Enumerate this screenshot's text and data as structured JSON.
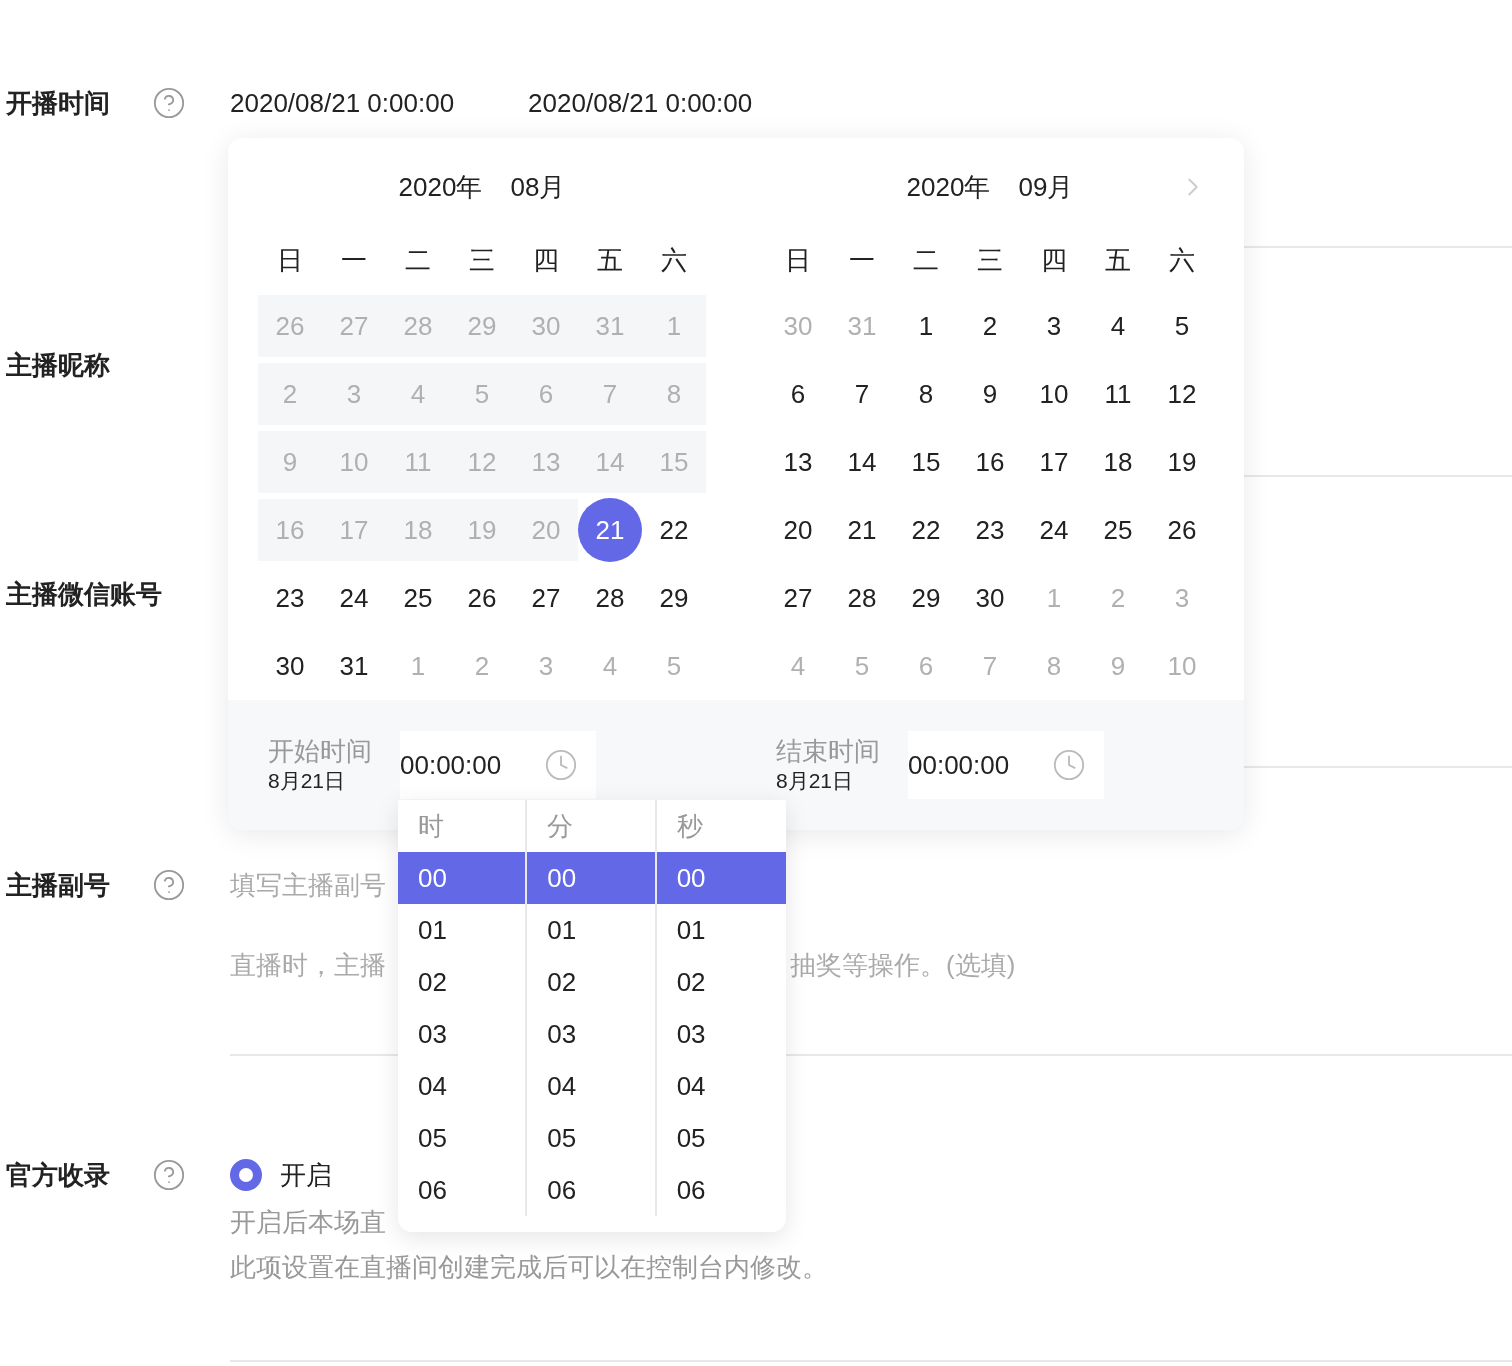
{
  "form": {
    "rows": [
      {
        "label": "开播时间",
        "help": true,
        "kind": "time_range",
        "start": "2020/08/21 0:00:00",
        "end": "2020/08/21 0:00:00"
      },
      {
        "label": "主播昵称",
        "help": false,
        "kind": "empty"
      },
      {
        "label": "主播微信账号",
        "help": false,
        "kind": "empty"
      },
      {
        "label": "主播副号",
        "help": true,
        "kind": "input",
        "placeholder": "填写主播副号",
        "hint": [
          "直播时，主播",
          "抽奖等操作。(选填)"
        ]
      },
      {
        "label": "官方收录",
        "help": true,
        "kind": "radio",
        "options": [
          {
            "label": "开启",
            "selected": true
          }
        ],
        "description": [
          "开启后本场直",
          "此项设置在直播间创建完成后可以在控制台内修改。"
        ]
      }
    ]
  },
  "calendar": {
    "months": [
      {
        "year": "2020年",
        "month": "08月",
        "weekdays": [
          "日",
          "一",
          "二",
          "三",
          "四",
          "五",
          "六"
        ],
        "weeks": [
          [
            {
              "text": "26",
              "kind": "disabled",
              "selected": false
            },
            {
              "text": "27",
              "kind": "disabled",
              "selected": false
            },
            {
              "text": "28",
              "kind": "disabled",
              "selected": false
            },
            {
              "text": "29",
              "kind": "disabled",
              "selected": false
            },
            {
              "text": "30",
              "kind": "disabled",
              "selected": false
            },
            {
              "text": "31",
              "kind": "disabled",
              "selected": false
            },
            {
              "text": "1",
              "kind": "disabled",
              "selected": false
            }
          ],
          [
            {
              "text": "2",
              "kind": "disabled",
              "selected": false
            },
            {
              "text": "3",
              "kind": "disabled",
              "selected": false
            },
            {
              "text": "4",
              "kind": "disabled",
              "selected": false
            },
            {
              "text": "5",
              "kind": "disabled",
              "selected": false
            },
            {
              "text": "6",
              "kind": "disabled",
              "selected": false
            },
            {
              "text": "7",
              "kind": "disabled",
              "selected": false
            },
            {
              "text": "8",
              "kind": "disabled",
              "selected": false
            }
          ],
          [
            {
              "text": "9",
              "kind": "disabled",
              "selected": false
            },
            {
              "text": "10",
              "kind": "disabled",
              "selected": false
            },
            {
              "text": "11",
              "kind": "disabled",
              "selected": false
            },
            {
              "text": "12",
              "kind": "disabled",
              "selected": false
            },
            {
              "text": "13",
              "kind": "disabled",
              "selected": false
            },
            {
              "text": "14",
              "kind": "disabled",
              "selected": false
            },
            {
              "text": "15",
              "kind": "disabled",
              "selected": false
            }
          ],
          [
            {
              "text": "16",
              "kind": "disabled",
              "selected": false
            },
            {
              "text": "17",
              "kind": "disabled",
              "selected": false
            },
            {
              "text": "18",
              "kind": "disabled",
              "selected": false
            },
            {
              "text": "19",
              "kind": "disabled",
              "selected": false
            },
            {
              "text": "20",
              "kind": "disabled",
              "selected": false
            },
            {
              "text": "21",
              "kind": "normal",
              "selected": true
            },
            {
              "text": "22",
              "kind": "normal",
              "selected": false
            }
          ],
          [
            {
              "text": "23",
              "kind": "normal",
              "selected": false
            },
            {
              "text": "24",
              "kind": "normal",
              "selected": false
            },
            {
              "text": "25",
              "kind": "normal",
              "selected": false
            },
            {
              "text": "26",
              "kind": "normal",
              "selected": false
            },
            {
              "text": "27",
              "kind": "normal",
              "selected": false
            },
            {
              "text": "28",
              "kind": "normal",
              "selected": false
            },
            {
              "text": "29",
              "kind": "normal",
              "selected": false
            }
          ],
          [
            {
              "text": "30",
              "kind": "normal",
              "selected": false
            },
            {
              "text": "31",
              "kind": "normal",
              "selected": false
            },
            {
              "text": "1",
              "kind": "outside",
              "selected": false
            },
            {
              "text": "2",
              "kind": "outside",
              "selected": false
            },
            {
              "text": "3",
              "kind": "outside",
              "selected": false
            },
            {
              "text": "4",
              "kind": "outside",
              "selected": false
            },
            {
              "text": "5",
              "kind": "outside",
              "selected": false
            }
          ]
        ]
      },
      {
        "year": "2020年",
        "month": "09月",
        "weekdays": [
          "日",
          "一",
          "二",
          "三",
          "四",
          "五",
          "六"
        ],
        "weeks": [
          [
            {
              "text": "30",
              "kind": "outside",
              "selected": false
            },
            {
              "text": "31",
              "kind": "outside",
              "selected": false
            },
            {
              "text": "1",
              "kind": "normal",
              "selected": false
            },
            {
              "text": "2",
              "kind": "normal",
              "selected": false
            },
            {
              "text": "3",
              "kind": "normal",
              "selected": false
            },
            {
              "text": "4",
              "kind": "normal",
              "selected": false
            },
            {
              "text": "5",
              "kind": "normal",
              "selected": false
            }
          ],
          [
            {
              "text": "6",
              "kind": "normal",
              "selected": false
            },
            {
              "text": "7",
              "kind": "normal",
              "selected": false
            },
            {
              "text": "8",
              "kind": "normal",
              "selected": false
            },
            {
              "text": "9",
              "kind": "normal",
              "selected": false
            },
            {
              "text": "10",
              "kind": "normal",
              "selected": false
            },
            {
              "text": "11",
              "kind": "normal",
              "selected": false
            },
            {
              "text": "12",
              "kind": "normal",
              "selected": false
            }
          ],
          [
            {
              "text": "13",
              "kind": "normal",
              "selected": false
            },
            {
              "text": "14",
              "kind": "normal",
              "selected": false
            },
            {
              "text": "15",
              "kind": "normal",
              "selected": false
            },
            {
              "text": "16",
              "kind": "normal",
              "selected": false
            },
            {
              "text": "17",
              "kind": "normal",
              "selected": false
            },
            {
              "text": "18",
              "kind": "normal",
              "selected": false
            },
            {
              "text": "19",
              "kind": "normal",
              "selected": false
            }
          ],
          [
            {
              "text": "20",
              "kind": "normal",
              "selected": false
            },
            {
              "text": "21",
              "kind": "normal",
              "selected": false
            },
            {
              "text": "22",
              "kind": "normal",
              "selected": false
            },
            {
              "text": "23",
              "kind": "normal",
              "selected": false
            },
            {
              "text": "24",
              "kind": "normal",
              "selected": false
            },
            {
              "text": "25",
              "kind": "normal",
              "selected": false
            },
            {
              "text": "26",
              "kind": "normal",
              "selected": false
            }
          ],
          [
            {
              "text": "27",
              "kind": "normal",
              "selected": false
            },
            {
              "text": "28",
              "kind": "normal",
              "selected": false
            },
            {
              "text": "29",
              "kind": "normal",
              "selected": false
            },
            {
              "text": "30",
              "kind": "normal",
              "selected": false
            },
            {
              "text": "1",
              "kind": "outside",
              "selected": false
            },
            {
              "text": "2",
              "kind": "outside",
              "selected": false
            },
            {
              "text": "3",
              "kind": "outside",
              "selected": false
            }
          ],
          [
            {
              "text": "4",
              "kind": "outside",
              "selected": false
            },
            {
              "text": "5",
              "kind": "outside",
              "selected": false
            },
            {
              "text": "6",
              "kind": "outside",
              "selected": false
            },
            {
              "text": "7",
              "kind": "outside",
              "selected": false
            },
            {
              "text": "8",
              "kind": "outside",
              "selected": false
            },
            {
              "text": "9",
              "kind": "outside",
              "selected": false
            },
            {
              "text": "10",
              "kind": "outside",
              "selected": false
            }
          ]
        ]
      }
    ],
    "times": [
      {
        "label": "开始时间",
        "date": "8月21日",
        "value": "00:00:00"
      },
      {
        "label": "结束时间",
        "date": "8月21日",
        "value": "00:00:00"
      }
    ]
  },
  "time_dropdown": {
    "columns": [
      {
        "header": "时",
        "items": [
          {
            "text": "00",
            "selected": true
          },
          {
            "text": "01",
            "selected": false
          },
          {
            "text": "02",
            "selected": false
          },
          {
            "text": "03",
            "selected": false
          },
          {
            "text": "04",
            "selected": false
          },
          {
            "text": "05",
            "selected": false
          },
          {
            "text": "06",
            "selected": false
          }
        ]
      },
      {
        "header": "分",
        "items": [
          {
            "text": "00",
            "selected": true
          },
          {
            "text": "01",
            "selected": false
          },
          {
            "text": "02",
            "selected": false
          },
          {
            "text": "03",
            "selected": false
          },
          {
            "text": "04",
            "selected": false
          },
          {
            "text": "05",
            "selected": false
          },
          {
            "text": "06",
            "selected": false
          }
        ]
      },
      {
        "header": "秒",
        "items": [
          {
            "text": "00",
            "selected": true
          },
          {
            "text": "01",
            "selected": false
          },
          {
            "text": "02",
            "selected": false
          },
          {
            "text": "03",
            "selected": false
          },
          {
            "text": "04",
            "selected": false
          },
          {
            "text": "05",
            "selected": false
          },
          {
            "text": "06",
            "selected": false
          }
        ]
      }
    ]
  }
}
